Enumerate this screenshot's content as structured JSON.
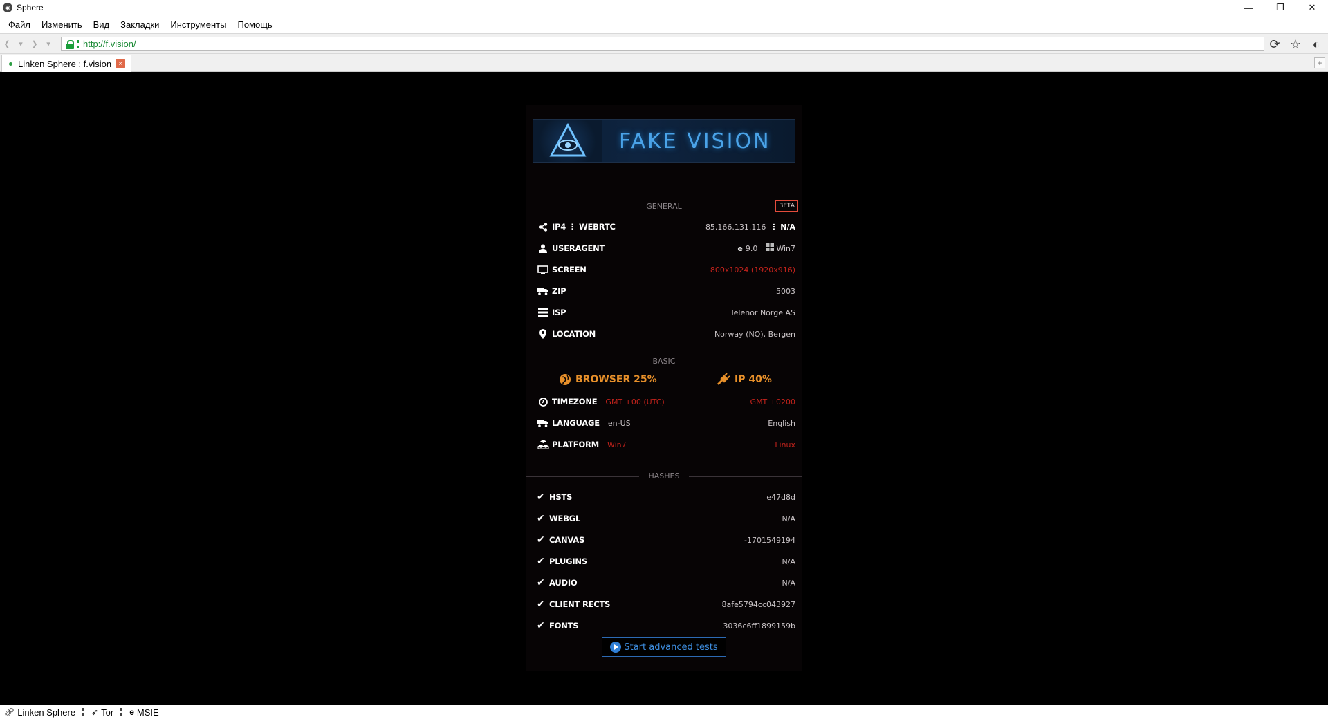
{
  "window": {
    "title": "Sphere",
    "minimize": "—",
    "restore": "❐",
    "close": "✕"
  },
  "menu": [
    "Файл",
    "Изменить",
    "Вид",
    "Закладки",
    "Инструменты",
    "Помощь"
  ],
  "address": {
    "url": "http://f.vision/"
  },
  "tab": {
    "label": "Linken Sphere : f.vision",
    "close": "×"
  },
  "new_tab": "+",
  "banner": {
    "title": "FAKE VISION"
  },
  "sections": {
    "general": "GENERAL",
    "basic": "BASIC",
    "hashes": "HASHES",
    "beta": "BETA"
  },
  "general": {
    "ip": {
      "label": "IP4 ⋮ WEBRTC",
      "value": "85.166.131.116",
      "value2": "⋮ N/A"
    },
    "useragent": {
      "label": "USERAGENT",
      "browser": "9.0",
      "os": "Win7"
    },
    "screen": {
      "label": "SCREEN",
      "value": "800x1024 (1920x916)"
    },
    "zip": {
      "label": "ZIP",
      "value": "5003"
    },
    "isp": {
      "label": "ISP",
      "value": "Telenor Norge AS"
    },
    "location": {
      "label": "LOCATION",
      "value": "Norway (NO), Bergen"
    }
  },
  "basic": {
    "browser_score": {
      "label": "BROWSER 25%",
      "percent": 25
    },
    "ip_score": {
      "label": "IP 40%",
      "percent": 40
    },
    "timezone": {
      "label": "TIMEZONE",
      "browser": "GMT +00 (UTC)",
      "ip": "GMT +0200"
    },
    "language": {
      "label": "LANGUAGE",
      "browser": "en-US",
      "ip": "English"
    },
    "platform": {
      "label": "PLATFORM",
      "browser": "Win7",
      "ip": "Linux"
    }
  },
  "hashes": [
    {
      "label": "HSTS",
      "value": "e47d8d"
    },
    {
      "label": "WEBGL",
      "value": "N/A"
    },
    {
      "label": "CANVAS",
      "value": "-1701549194"
    },
    {
      "label": "PLUGINS",
      "value": "N/A"
    },
    {
      "label": "AUDIO",
      "value": "N/A"
    },
    {
      "label": "CLIENT RECTS",
      "value": "8afe5794cc043927"
    },
    {
      "label": "FONTS",
      "value": "3036c6ff1899159b"
    }
  ],
  "advanced_button": "Start advanced tests",
  "status": {
    "item1": "Linken Sphere",
    "item2": "Tor",
    "item3": "MSIE"
  },
  "colors": {
    "accent_blue": "#2f7fd6",
    "warning_red": "#c3231c",
    "score_orange": "#e8902a",
    "secure_green": "#1a9e3a"
  }
}
